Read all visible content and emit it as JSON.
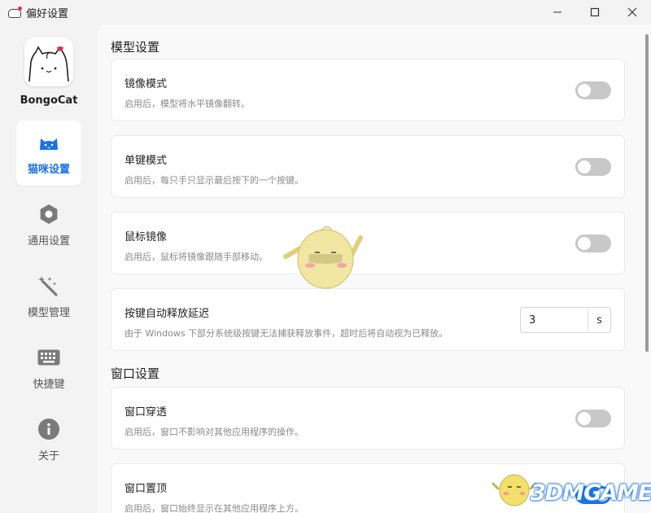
{
  "window": {
    "title": "偏好设置",
    "controls": {
      "minimize": "minimize-icon",
      "maximize": "maximize-icon",
      "close": "close-icon"
    }
  },
  "sidebar": {
    "logo_text": "BongoCat",
    "items": [
      {
        "label": "猫咪设置",
        "icon": "cat-icon",
        "active": true
      },
      {
        "label": "通用设置",
        "icon": "gear-icon",
        "active": false
      },
      {
        "label": "模型管理",
        "icon": "magic-wand-icon",
        "active": false
      },
      {
        "label": "快捷键",
        "icon": "keyboard-icon",
        "active": false
      },
      {
        "label": "关于",
        "icon": "info-icon",
        "active": false
      }
    ]
  },
  "sections": [
    {
      "title": "模型设置",
      "cards": [
        {
          "title": "镜像模式",
          "desc": "启用后，模型将水平镜像翻转。",
          "control": "toggle",
          "checked": false
        },
        {
          "title": "单键模式",
          "desc": "启用后，每只手只显示最后按下的一个按键。",
          "control": "toggle",
          "checked": false
        },
        {
          "title": "鼠标镜像",
          "desc": "启用后，鼠标将镜像跟随手部移动。",
          "control": "toggle",
          "checked": false
        },
        {
          "title": "按键自动释放延迟",
          "desc": "由于 Windows 下部分系统级按键无法捕获释放事件，超时后将自动视为已释放。",
          "control": "number",
          "value": "3",
          "unit": "s"
        }
      ]
    },
    {
      "title": "窗口设置",
      "cards": [
        {
          "title": "窗口穿透",
          "desc": "启用后，窗口不影响对其他应用程序的操作。",
          "control": "toggle",
          "checked": false
        },
        {
          "title": "窗口置顶",
          "desc": "启用后，窗口始终显示在其他应用程序上方。",
          "control": "toggle",
          "checked": true
        }
      ]
    }
  ],
  "watermark": "3DMGAME",
  "colors": {
    "accent": "#1a73e8",
    "toggle_off": "#c8c8c8",
    "background": "#f3f3f3",
    "card": "#ffffff"
  }
}
